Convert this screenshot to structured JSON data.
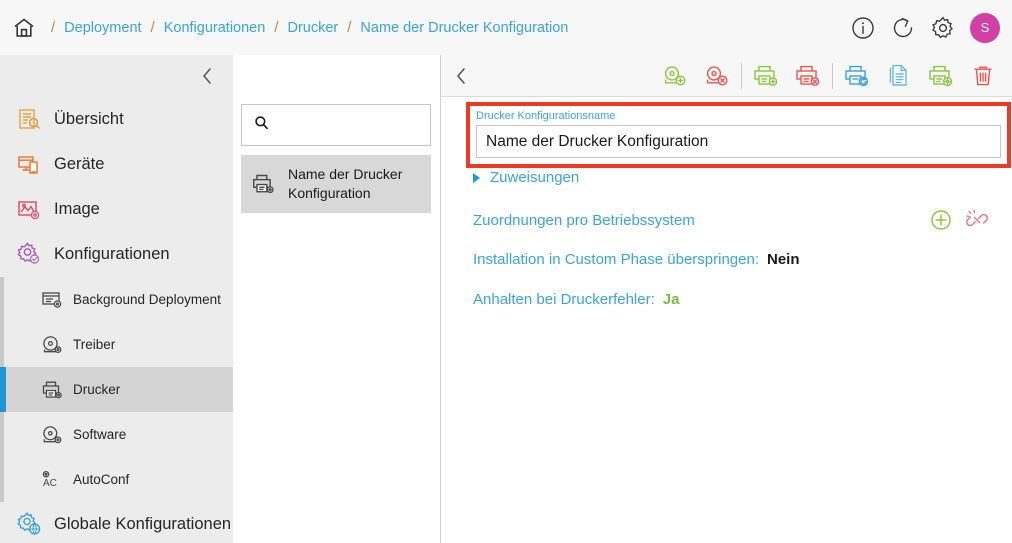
{
  "breadcrumb": {
    "home_icon": "home-icon",
    "separator": "/",
    "items": [
      {
        "label": "Deployment"
      },
      {
        "label": "Konfigurationen"
      },
      {
        "label": "Drucker"
      },
      {
        "label": "Name der Drucker Konfiguration"
      }
    ]
  },
  "topbar_actions": {
    "info_icon": "info-circle-icon",
    "refresh_icon": "refresh-icon",
    "settings_icon": "gear-icon",
    "avatar_initial": "S",
    "avatar_color": "#d23fa5"
  },
  "sidebar": {
    "collapse_icon": "chevron-left-icon",
    "items": [
      {
        "label": "Übersicht",
        "icon": "overview-document-search-icon",
        "color": "#e8a33d"
      },
      {
        "label": "Geräte",
        "icon": "devices-icon",
        "color": "#e8742f"
      },
      {
        "label": "Image",
        "icon": "image-gear-icon",
        "color": "#e0485e"
      },
      {
        "label": "Konfigurationen",
        "icon": "configuration-gear-icon",
        "color": "#a05ab5"
      }
    ],
    "sub_items": [
      {
        "label": "Background Deployment",
        "icon": "background-deployment-icon",
        "selected": false
      },
      {
        "label": "Treiber",
        "icon": "driver-disc-icon",
        "selected": false
      },
      {
        "label": "Drucker",
        "icon": "printer-icon",
        "selected": true
      },
      {
        "label": "Software",
        "icon": "software-disc-icon",
        "selected": false
      },
      {
        "label": "AutoConf",
        "icon": "autoconf-icon",
        "selected": false
      }
    ],
    "global": {
      "label": "Globale Konfigurationen",
      "icon": "global-configuration-icon",
      "color": "#3a9fd8"
    },
    "accent_color": "#2196d6"
  },
  "list_panel": {
    "search": {
      "value": "",
      "placeholder": "",
      "icon": "search-icon"
    },
    "items": [
      {
        "label": "Name der Drucker Konfiguration",
        "icon": "printer-icon",
        "selected": true
      }
    ]
  },
  "toolbar": {
    "back_icon": "chevron-left-icon",
    "buttons": [
      {
        "name": "add-driver-disc-button",
        "icon": "disc-plus-icon",
        "color": "#8dc63f"
      },
      {
        "name": "remove-driver-disc-button",
        "icon": "disc-remove-icon",
        "color": "#ef5350"
      },
      {
        "name": "add-printer-button",
        "icon": "printer-plus-icon",
        "color": "#8dc63f"
      },
      {
        "name": "delete-printer-button",
        "icon": "printer-remove-icon",
        "color": "#ef5350"
      },
      {
        "name": "sync-printer-button",
        "icon": "printer-sync-icon",
        "color": "#3aa3dd"
      },
      {
        "name": "copy-document-button",
        "icon": "document-copy-icon",
        "color": "#6cb8e0"
      },
      {
        "name": "printer-settings-button",
        "icon": "printer-gear-icon",
        "color": "#8dc63f"
      },
      {
        "name": "delete-button",
        "icon": "trash-icon",
        "color": "#ef5350"
      }
    ]
  },
  "main": {
    "name_field": {
      "label": "Drucker Konfigurationsname",
      "value": "Name der Drucker Konfiguration",
      "placeholder": "",
      "highlight_color": "#ec3a25"
    },
    "assignments_toggle": {
      "label": "Zuweisungen",
      "icon": "triangle-right-icon"
    },
    "os_assignments": {
      "label": "Zuordnungen pro Betriebssystem",
      "add_icon": "plus-circle-icon",
      "unlink_icon": "broken-link-icon"
    },
    "skip_custom_phase": {
      "key": "Installation in Custom Phase überspringen:",
      "value": "Nein"
    },
    "halt_on_printer_error": {
      "key": "Anhalten bei Druckerfehler:",
      "value": "Ja"
    }
  }
}
